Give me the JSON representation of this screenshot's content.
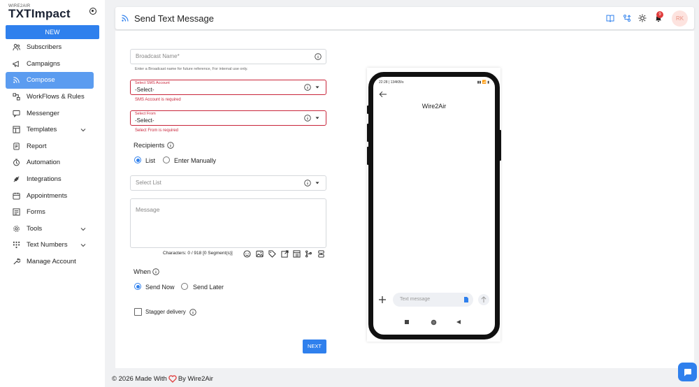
{
  "app": {
    "logo_small": "WIRE2AIR",
    "logo": "TXTImpact",
    "new_label": "NEW"
  },
  "sidebar": {
    "items": [
      {
        "label": "Subscribers",
        "icon": "users-icon"
      },
      {
        "label": "Campaigns",
        "icon": "megaphone-icon"
      },
      {
        "label": "Compose",
        "icon": "rss-icon",
        "active": true
      },
      {
        "label": "WorkFlows & Rules",
        "icon": "workflow-icon"
      },
      {
        "label": "Messenger",
        "icon": "chat-icon"
      },
      {
        "label": "Templates",
        "icon": "template-icon",
        "expandable": true
      },
      {
        "label": "Report",
        "icon": "report-icon"
      },
      {
        "label": "Automation",
        "icon": "timer-icon"
      },
      {
        "label": "Integrations",
        "icon": "plug-icon"
      },
      {
        "label": "Appointments",
        "icon": "calendar-icon"
      },
      {
        "label": "Forms",
        "icon": "forms-icon"
      },
      {
        "label": "Tools",
        "icon": "gear-icon",
        "expandable": true
      },
      {
        "label": "Text Numbers",
        "icon": "grid-icon",
        "expandable": true
      },
      {
        "label": "Manage Account",
        "icon": "wrench-icon"
      }
    ]
  },
  "header": {
    "title": "Send Text Message",
    "notification_count": "9",
    "avatar_initials": "RK"
  },
  "form": {
    "broadcast_name_placeholder": "Broadcast Name*",
    "broadcast_name_helper": "Enter a Broadcast name for future reference, For internal use only.",
    "sms_account_label": "Select SMS Account",
    "sms_account_value": "-Select-",
    "sms_account_error": "SMS Account is required",
    "from_label": "Select From",
    "from_value": "-Select-",
    "from_error": "Select From is required",
    "recipients_label": "Recipients",
    "recipient_option_list": "List",
    "recipient_option_manual": "Enter Manually",
    "select_list_placeholder": "Select List",
    "message_placeholder": "Message",
    "char_count": "Characters: 0 / 918 [0 Segment(s)]",
    "when_label": "When",
    "when_option_now": "Send Now",
    "when_option_later": "Send Later",
    "stagger_label": "Stagger delivery",
    "next_label": "NEXT"
  },
  "phone": {
    "status_time": "22:28 | 134KB/s",
    "status_right": "▮▮ 📶 ▮",
    "title": "Wire2Air",
    "compose_placeholder": "Text message"
  },
  "footer": {
    "prefix": "© 2026 Made With",
    "suffix": "By Wire2Air"
  },
  "colors": {
    "accent": "#2f80ed",
    "active_nav": "#5b9cf0",
    "error": "#c9253a",
    "heart": "#e03b3b"
  }
}
